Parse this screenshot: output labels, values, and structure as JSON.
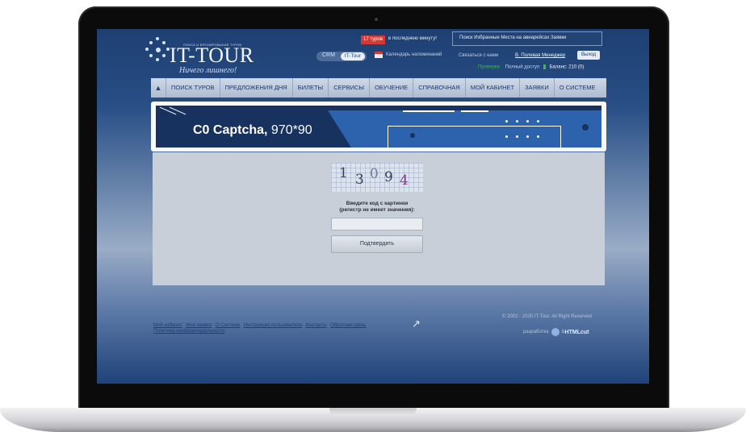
{
  "header": {
    "logo_tagline": "ПОИСК И БРОНИРОВАНИЕ ТУРОВ",
    "logo_name": "IT-TOUR",
    "logo_slogan": "Ничего лишнего!",
    "crm_label": "CRM",
    "tour_label": "IT-Tour",
    "tours_badge": "17 туров",
    "tours_note": "в последнюю минуту!",
    "top_links": "Поиск  Избранные  Места на авиарейсах  Заявки",
    "calendar_label": "Календарь напоминаний",
    "contact_link": "Связаться с нами",
    "user_link": "В. Полевая Менеджер",
    "logout_label": "Выход",
    "status_check": "Проверка",
    "status_access": "Полный доступ",
    "status_balance": "Баланс: 210 (0)"
  },
  "nav": {
    "items": [
      "ПОИСК ТУРОВ",
      "ПРЕДЛОЖЕНИЯ ДНЯ",
      "БИЛЕТЫ",
      "СЕРВИСЫ",
      "ОБУЧЕНИЕ",
      "СПРАВОЧНАЯ",
      "МОЙ КАБИНЕТ",
      "ЗАЯВКИ",
      "О СИСТЕМЕ"
    ]
  },
  "banner": {
    "title_bold": "C0 Captcha,",
    "title_size": " 970*90"
  },
  "captcha": {
    "digits": [
      "1",
      "3",
      "0",
      "9",
      "4"
    ],
    "label_line1": "Введите код с картинки",
    "label_line2": "(регистр не имеет значения):",
    "input_value": "",
    "submit_label": "Подтвердить"
  },
  "footer": {
    "links_row1": [
      "Мой кабинет",
      "Мои заявки",
      "О Системе",
      "Инструкция пользователя",
      "Контакты",
      "Обратная связь"
    ],
    "links_row2": [
      "Политика конфиденциальности"
    ],
    "copyright": "© 2002 - 2020 IT-Tour. All Right Reserved",
    "dev_label": "разработка",
    "dev_sep": "& ",
    "dev_brand": "HTMLcut"
  },
  "colors": {
    "screen_blue": "#284f86",
    "banner_blue": "#2d62ac",
    "banner_navy": "#17325e",
    "badge_red": "#d23b35"
  }
}
